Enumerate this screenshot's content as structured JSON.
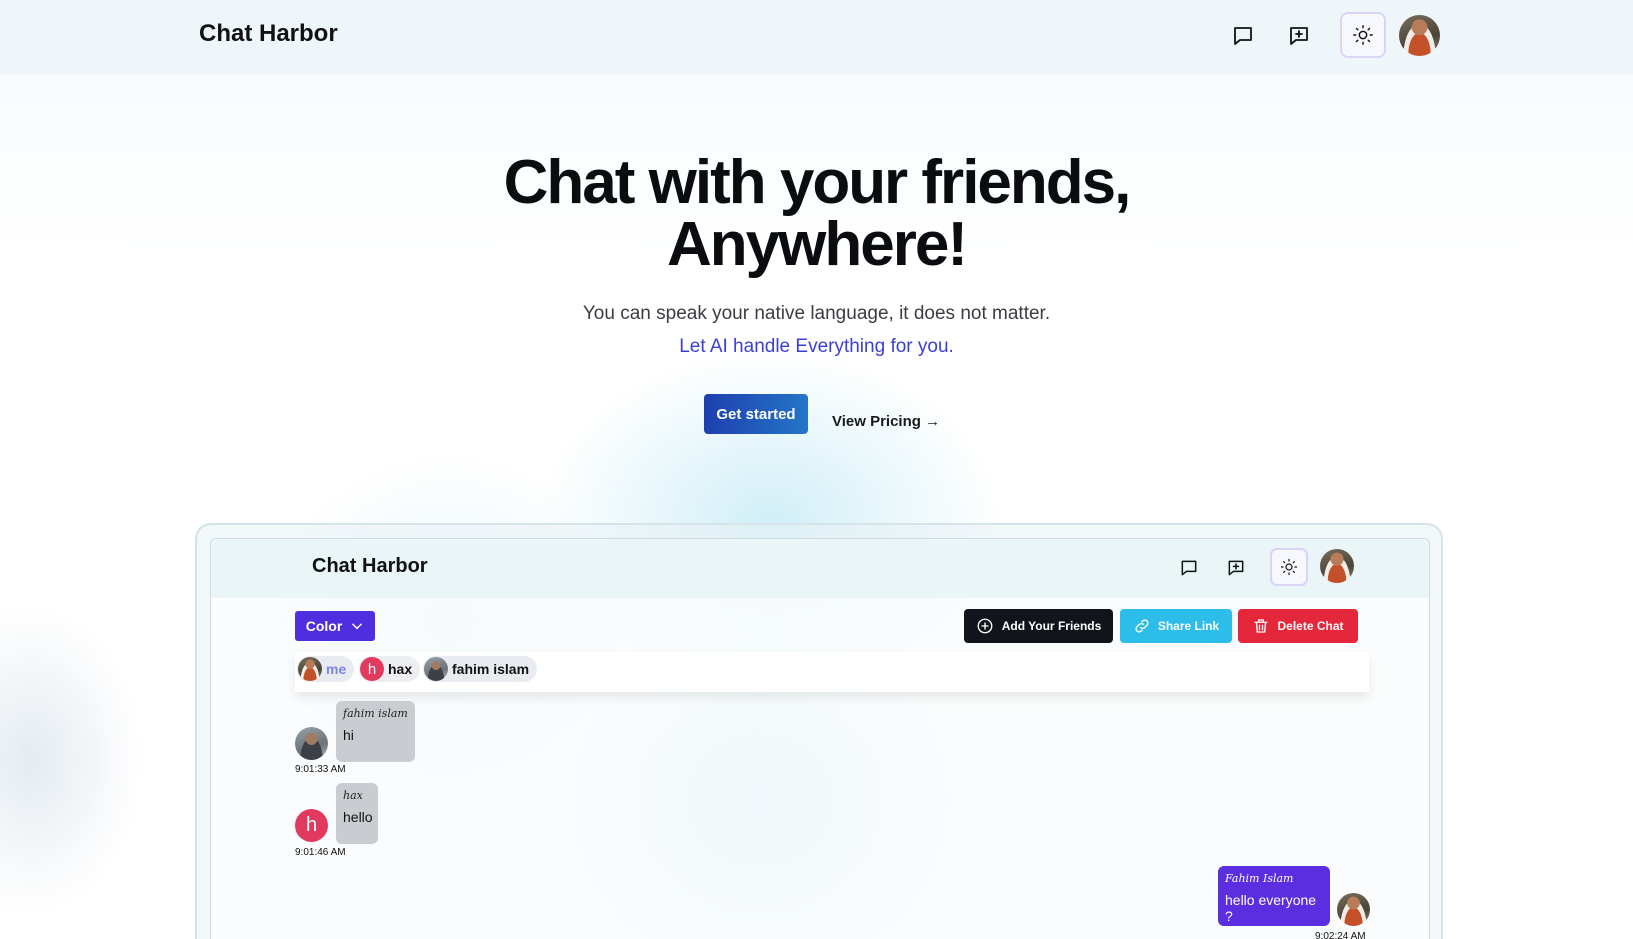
{
  "navbar": {
    "brand": "Chat Harbor",
    "icons": [
      "chat-icon",
      "new-chat-icon",
      "sun-icon"
    ]
  },
  "hero": {
    "title_line1": "Chat with your friends,",
    "title_line2": "Anywhere!",
    "subtitle": "You can speak your native language, it does not matter.",
    "ai_line": "Let AI handle Everything for you.",
    "cta_label": "Get started",
    "pricing_label": "View Pricing →"
  },
  "preview": {
    "brand": "Chat Harbor",
    "color_button": "Color",
    "add_friends": "Add Your Friends",
    "share_link": "Share Link",
    "delete_chat": "Delete Chat",
    "members": [
      {
        "name": "me",
        "avatar": "photo"
      },
      {
        "name": "hax",
        "avatar": "h"
      },
      {
        "name": "fahim islam",
        "avatar": "photo"
      }
    ],
    "messages": [
      {
        "author": "fahim islam",
        "text": "hi",
        "time": "9:01:33 AM",
        "side": "left"
      },
      {
        "author": "hax",
        "text": "hello",
        "time": "9:01:46 AM",
        "side": "left"
      },
      {
        "author": "Fahim Islam",
        "text": "hello everyone ?",
        "time": "9:02:24 AM",
        "side": "right"
      }
    ]
  },
  "colors": {
    "primary_purple": "#4f2ee0",
    "cta_blue": "#1e40af",
    "share_cyan": "#2dbde9",
    "delete_red": "#e5273b",
    "ai_text": "#3b3fd6"
  }
}
